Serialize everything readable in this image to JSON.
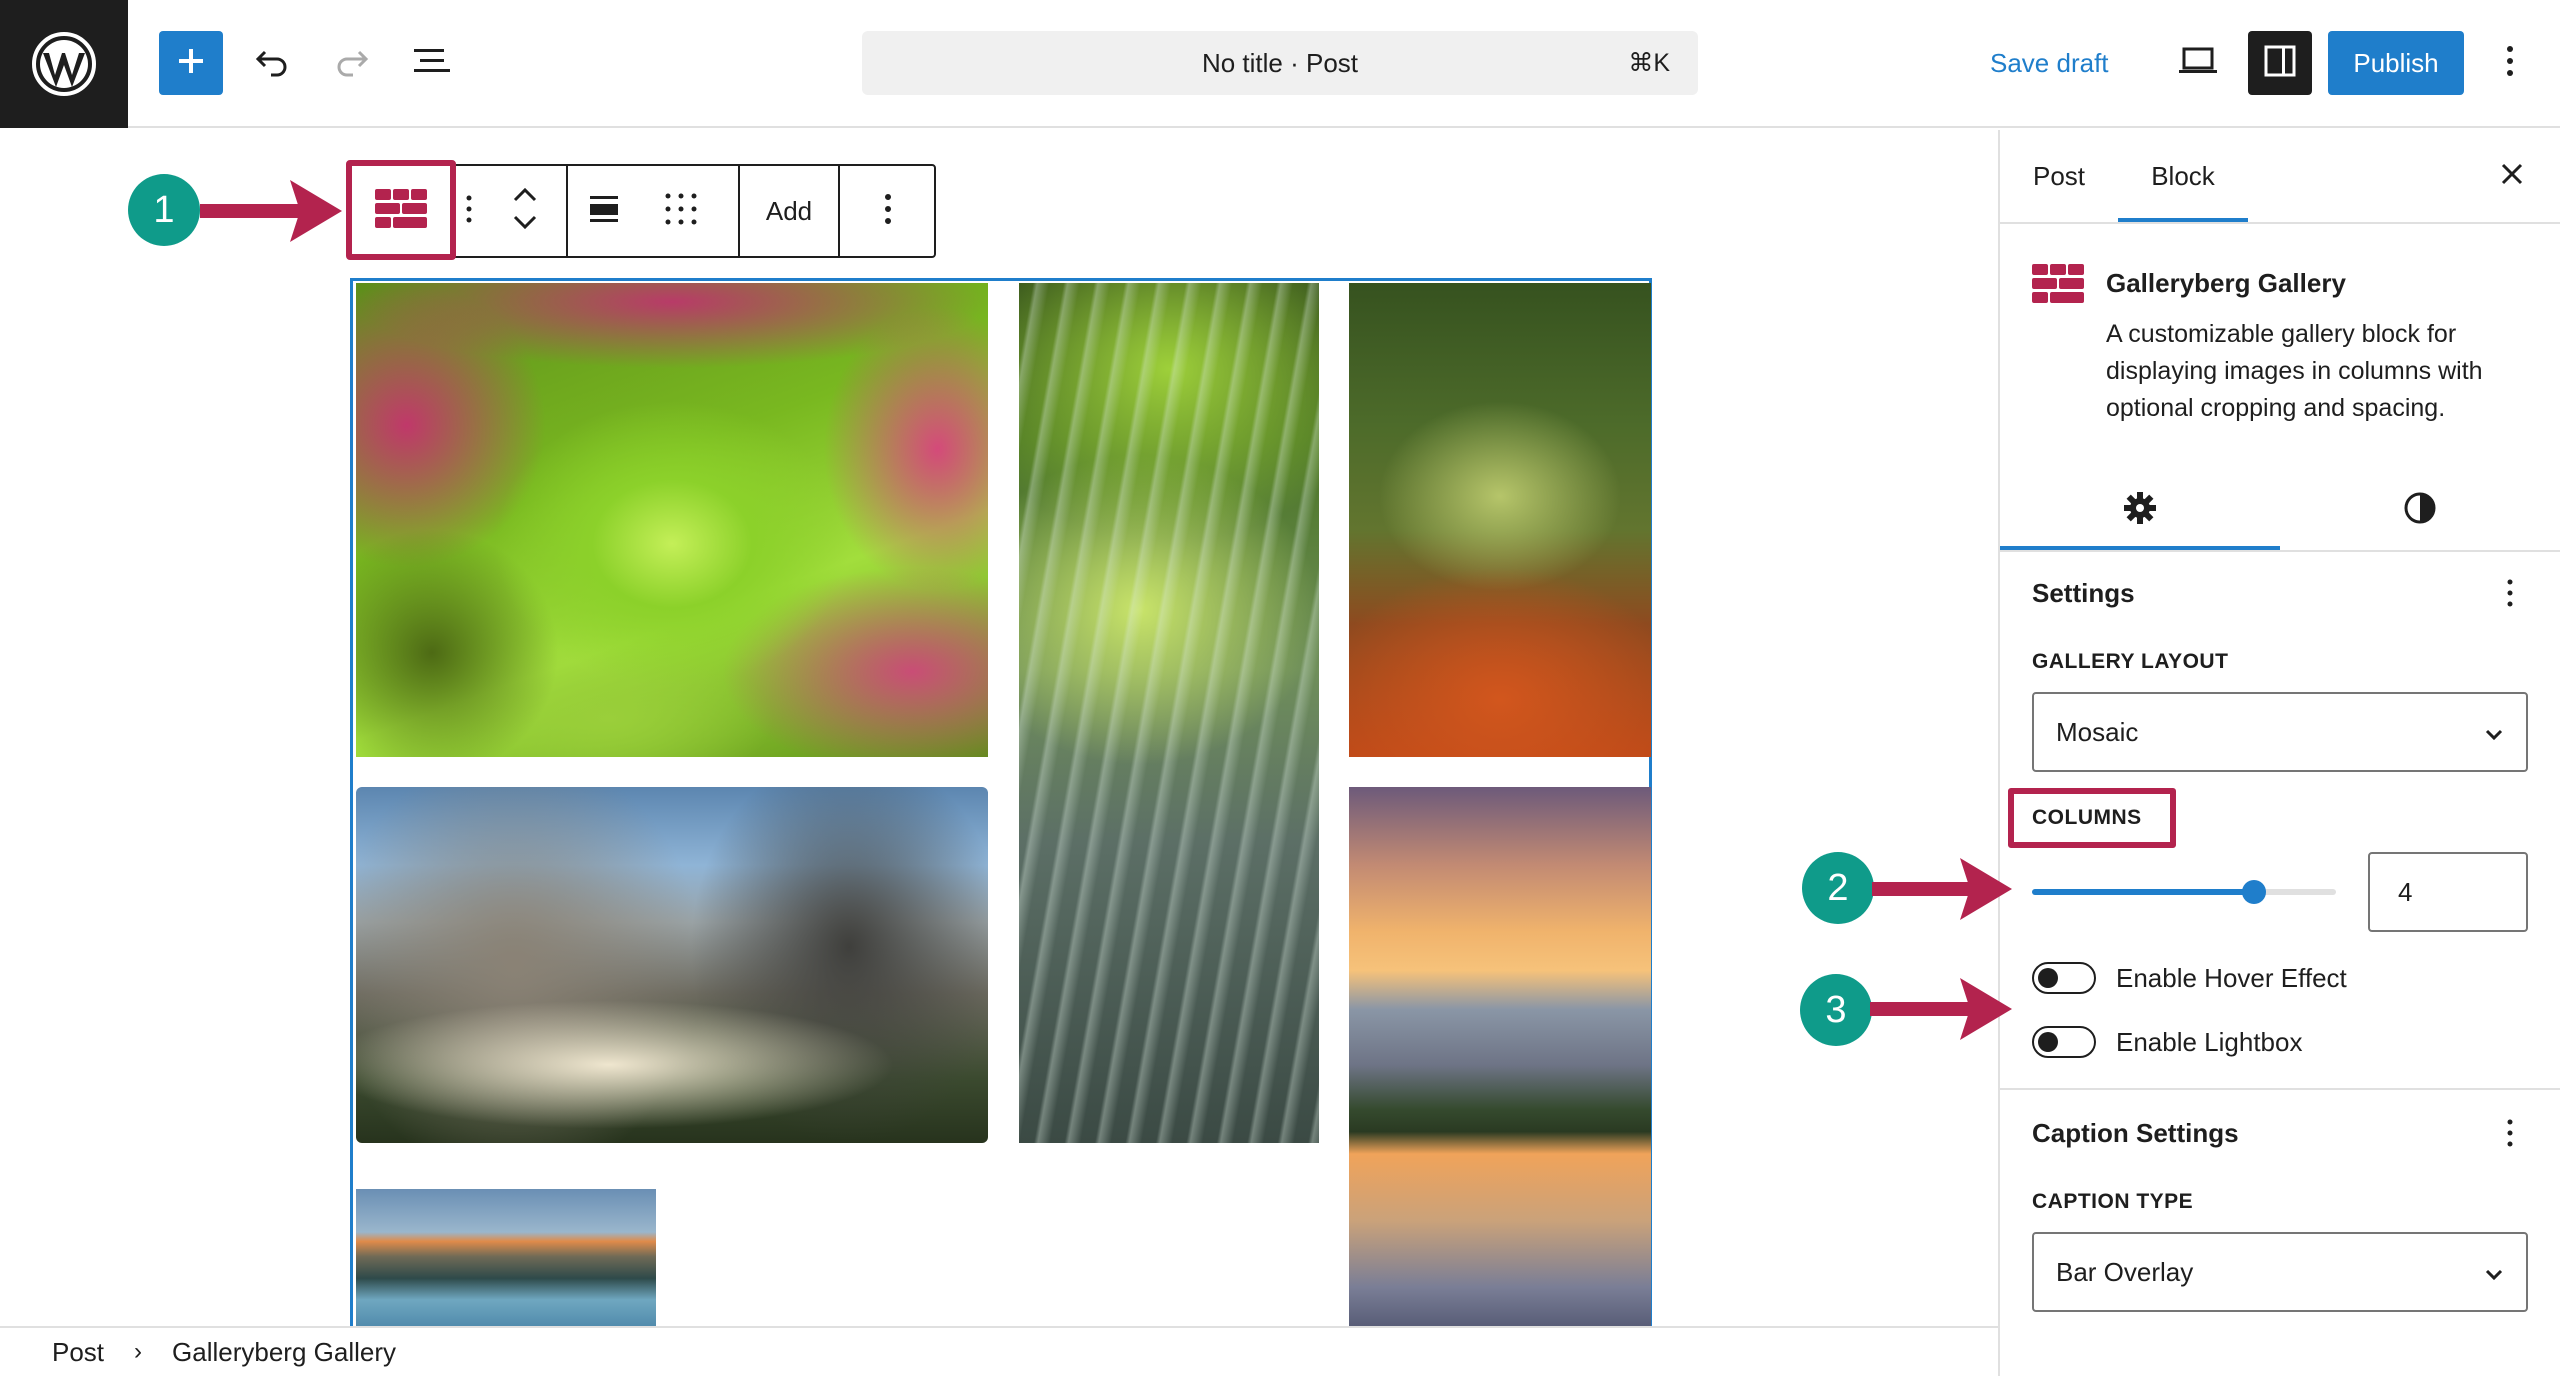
{
  "topbar": {
    "document_title": "No title · Post",
    "shortcut": "⌘K",
    "save_draft": "Save draft",
    "publish": "Publish"
  },
  "block_toolbar": {
    "add_label": "Add"
  },
  "gallery": {
    "images": [
      "flowering-branch",
      "forest-sunrays",
      "autumn-forest-path",
      "mountain-valley-fog",
      "mountain-lake-sunset",
      "alpine-lake-reflection"
    ]
  },
  "breadcrumb": {
    "items": [
      "Post",
      "Galleryberg Gallery"
    ],
    "separator": "›"
  },
  "sidebar": {
    "tabs": [
      "Post",
      "Block"
    ],
    "active_tab": "Block",
    "block_card": {
      "title": "Galleryberg Gallery",
      "description": "A customizable gallery block for displaying images in columns with optional cropping and spacing."
    },
    "settings_panel": {
      "title": "Settings",
      "gallery_layout_label": "GALLERY LAYOUT",
      "gallery_layout_value": "Mosaic",
      "columns_label": "COLUMNS",
      "columns_value": "4",
      "columns_slider_fraction": 0.73,
      "hover_label": "Enable Hover Effect",
      "lightbox_label": "Enable Lightbox"
    },
    "caption_panel": {
      "title": "Caption Settings",
      "caption_type_label": "CAPTION TYPE",
      "caption_type_value": "Bar Overlay"
    }
  },
  "annotations": {
    "badges": [
      "1",
      "2",
      "3"
    ],
    "accent_color": "#b3234e",
    "badge_color": "#0f9b8a"
  },
  "colors": {
    "wp_blue": "#1f7ecb",
    "dark": "#1e1e1e"
  }
}
